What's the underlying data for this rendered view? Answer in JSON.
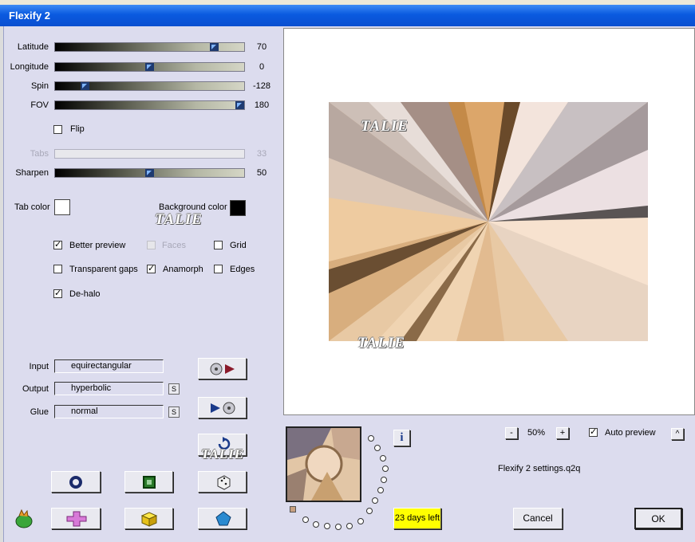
{
  "window": {
    "title": "Flexify 2"
  },
  "sliders": [
    {
      "id": "latitude",
      "label": "Latitude",
      "value": "70",
      "fraction": 0.86
    },
    {
      "id": "longitude",
      "label": "Longitude",
      "value": "0",
      "fraction": 0.5
    },
    {
      "id": "spin",
      "label": "Spin",
      "value": "-128",
      "fraction": 0.14
    },
    {
      "id": "fov",
      "label": "FOV",
      "value": "180",
      "fraction": 1.0
    },
    {
      "id": "tabs",
      "label": "Tabs",
      "value": "33",
      "disabled": true
    },
    {
      "id": "sharpen",
      "label": "Sharpen",
      "value": "50",
      "fraction": 0.5
    }
  ],
  "flip": {
    "label": "Flip",
    "checked": false
  },
  "colors": {
    "tab_color_label": "Tab color",
    "tab_color": "#ffffff",
    "background_color_label": "Background color",
    "background_color": "#000000",
    "accent": "#ffff00"
  },
  "options": {
    "better_preview": {
      "label": "Better preview",
      "checked": true
    },
    "faces": {
      "label": "Faces",
      "checked": false,
      "disabled": true
    },
    "grid": {
      "label": "Grid",
      "checked": false
    },
    "transparent_gaps": {
      "label": "Transparent gaps",
      "checked": false
    },
    "anamorph": {
      "label": "Anamorph",
      "checked": true
    },
    "edges": {
      "label": "Edges",
      "checked": false
    },
    "de_halo": {
      "label": "De-halo",
      "checked": true
    }
  },
  "projection": {
    "input_label": "Input",
    "input_value": "equirectangular",
    "output_label": "Output",
    "output_value": "hyperbolic",
    "glue_label": "Glue",
    "glue_value": "normal",
    "s_label": "S"
  },
  "watermark": "TALIE",
  "preview": {
    "zoom_minus": "-",
    "zoom": "50%",
    "zoom_plus": "+"
  },
  "auto_preview": {
    "label": "Auto preview",
    "checked": true
  },
  "caret": "^",
  "info_label": "i",
  "settings_file": "Flexify 2 settings.q2q",
  "trial": "23 days left",
  "buttons": {
    "cancel": "Cancel",
    "ok": "OK"
  }
}
